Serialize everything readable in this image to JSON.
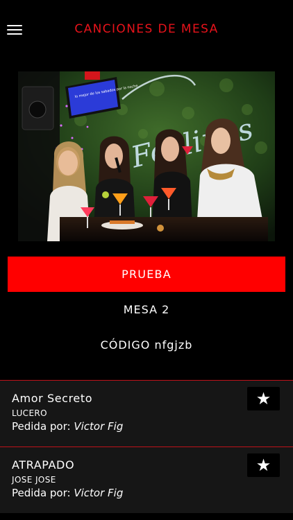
{
  "header": {
    "title": "CANCIONES DE MESA",
    "menu_icon": "hamburger-menu-icon"
  },
  "hero": {
    "sign_text": "Feelings",
    "screen_text": "lo mejor de los sabados por la noche"
  },
  "primary_button": {
    "label": "PRUEBA"
  },
  "table": {
    "name": "MESA 2",
    "code_line": "CÓDIGO nfgjzb"
  },
  "songs": [
    {
      "title": "Amor Secreto",
      "artist": "LUCERO",
      "requested_label": "Pedida por:",
      "requested_by": "Victor Fig",
      "icon": "star-icon"
    },
    {
      "title": "ATRAPADO",
      "artist": "JOSE JOSE",
      "requested_label": "Pedida por:",
      "requested_by": "Victor Fig",
      "icon": "star-icon"
    }
  ],
  "colors": {
    "accent": "#ff0000",
    "title": "#e8131b",
    "background": "#000000",
    "list_background": "#161616",
    "divider": "#c0121a"
  }
}
